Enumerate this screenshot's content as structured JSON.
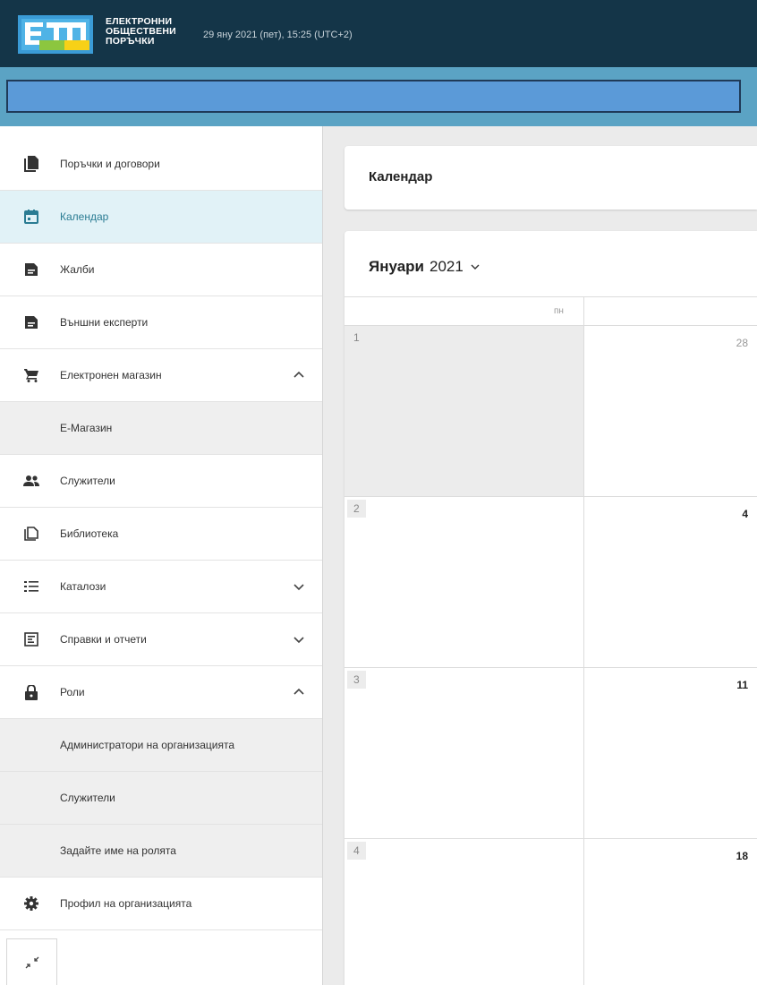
{
  "header": {
    "logo_lines": [
      "ЕЛЕКТРОННИ",
      "ОБЩЕСТВЕНИ",
      "ПОРЪЧКИ"
    ],
    "datetime": "29 яну 2021 (пет), 15:25 (UTC+2)"
  },
  "sidebar": {
    "items": [
      {
        "label": "Поръчки и договори",
        "icon": "document-icon"
      },
      {
        "label": "Календар",
        "icon": "calendar-icon",
        "active": true
      },
      {
        "label": "Жалби",
        "icon": "file-text-icon"
      },
      {
        "label": "Външни експерти",
        "icon": "file-text-icon"
      },
      {
        "label": "Електронен магазин",
        "icon": "cart-icon",
        "chevron": "up"
      },
      {
        "label": "Е-Магазин",
        "sub": true
      },
      {
        "label": "Служители",
        "icon": "people-icon"
      },
      {
        "label": "Библиотека",
        "icon": "library-icon"
      },
      {
        "label": "Каталози",
        "icon": "list-icon",
        "chevron": "down"
      },
      {
        "label": "Справки и отчети",
        "icon": "report-icon",
        "chevron": "down"
      },
      {
        "label": "Роли",
        "icon": "lock-icon",
        "chevron": "up"
      },
      {
        "label": "Администратори на организацията",
        "sub": true
      },
      {
        "label": "Служители",
        "sub": true
      },
      {
        "label": "Задайте име на ролята",
        "sub": true
      },
      {
        "label": "Профил на организацията",
        "icon": "gear-icon"
      }
    ]
  },
  "main": {
    "title": "Календар",
    "month": "Януари",
    "year": "2021",
    "day_header": "пн",
    "weeks": [
      {
        "week": "1",
        "day": "28",
        "other_month": true
      },
      {
        "week": "2",
        "day": "4"
      },
      {
        "week": "3",
        "day": "11"
      },
      {
        "week": "4",
        "day": "18"
      }
    ]
  },
  "colors": {
    "header_bg": "#143548",
    "bluebar_bg": "#5ba3c4",
    "active_item_bg": "#e1f2f7",
    "accent": "#2a7c93"
  }
}
